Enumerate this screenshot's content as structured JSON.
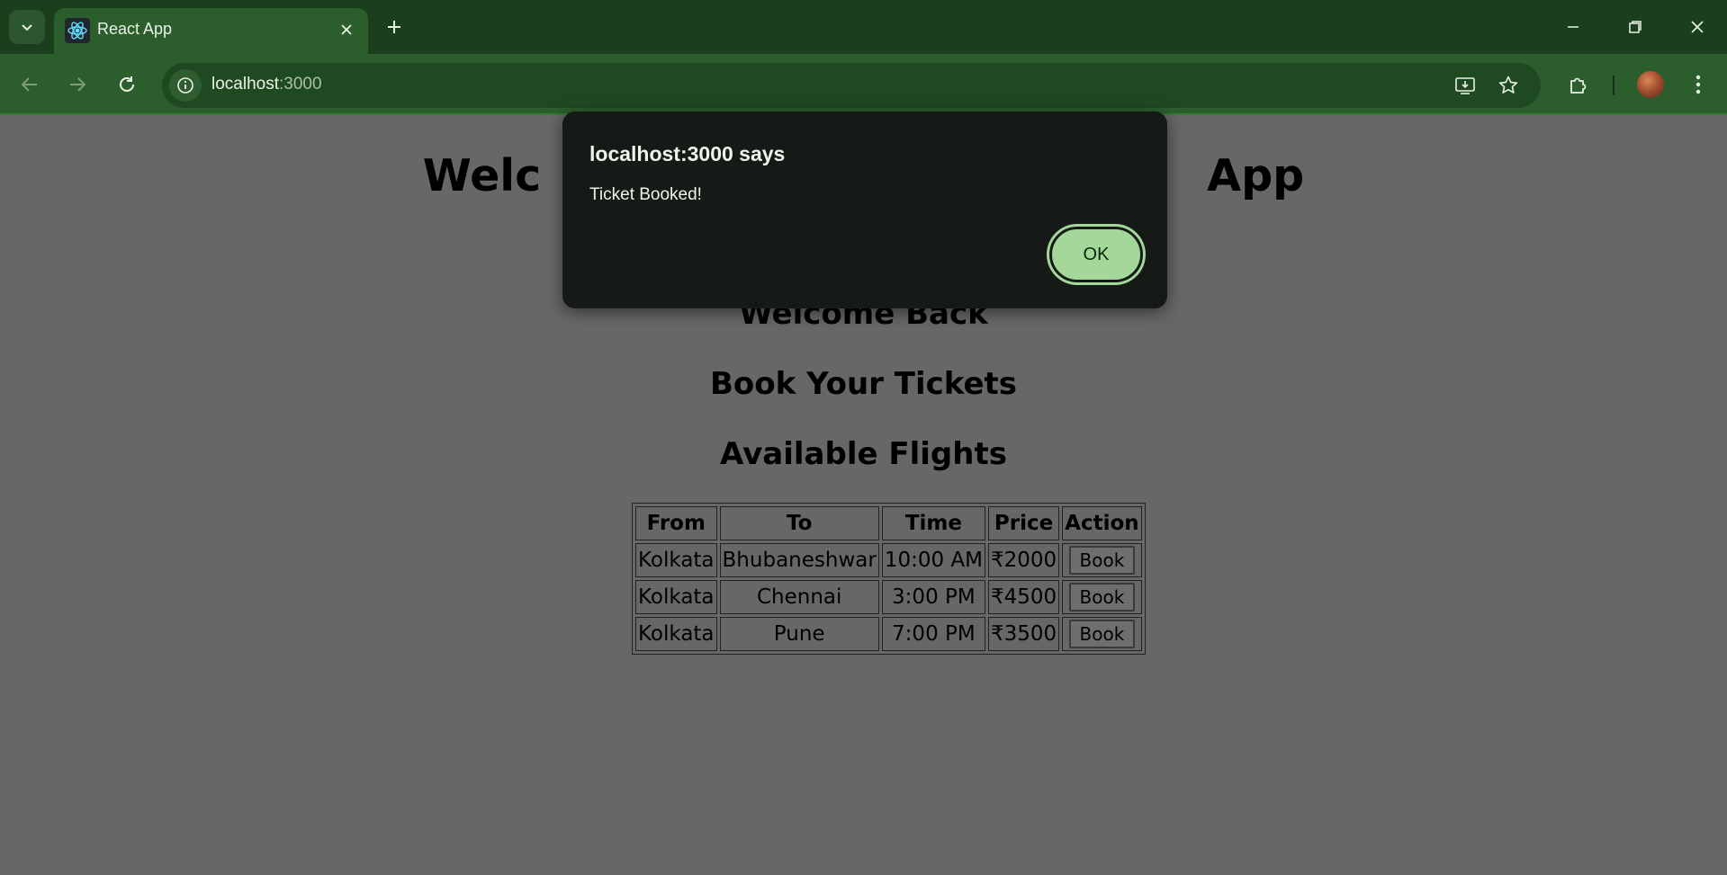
{
  "browser": {
    "tab_title": "React App",
    "url_host": "localhost",
    "url_port": ":3000"
  },
  "page": {
    "title_left": "Welc",
    "title_right": "App",
    "welcome": "Welcome Back",
    "book_heading": "Book Your Tickets",
    "flights_heading": "Available Flights",
    "table": {
      "headers": [
        "From",
        "To",
        "Time",
        "Price",
        "Action"
      ],
      "rows": [
        {
          "from": "Kolkata",
          "to": "Bhubaneshwar",
          "time": "10:00 AM",
          "price": "₹2000",
          "action": "Book"
        },
        {
          "from": "Kolkata",
          "to": "Chennai",
          "time": "3:00 PM",
          "price": "₹4500",
          "action": "Book"
        },
        {
          "from": "Kolkata",
          "to": "Pune",
          "time": "7:00 PM",
          "price": "₹3500",
          "action": "Book"
        }
      ]
    }
  },
  "dialog": {
    "title": "localhost:3000 says",
    "message": "Ticket Booked!",
    "ok_label": "OK"
  },
  "colors": {
    "tabbar": "#1b3e1c",
    "toolbar": "#2c5e2d",
    "page_bg": "#676767",
    "dialog_bg": "#161a17",
    "ok_button": "#a3d89a"
  },
  "icons": {
    "tab_search": "chevron-down-icon",
    "favicon": "react-logo-icon",
    "tab_close": "close-icon",
    "new_tab": "plus-icon",
    "minimize": "minimize-icon",
    "restore": "restore-icon",
    "close_window": "close-icon",
    "back": "arrow-left-icon",
    "forward": "arrow-right-icon",
    "reload": "reload-icon",
    "site_info": "info-icon",
    "install": "install-app-icon",
    "bookmark": "star-icon",
    "extensions": "puzzle-icon",
    "menu": "kebab-menu-icon"
  }
}
